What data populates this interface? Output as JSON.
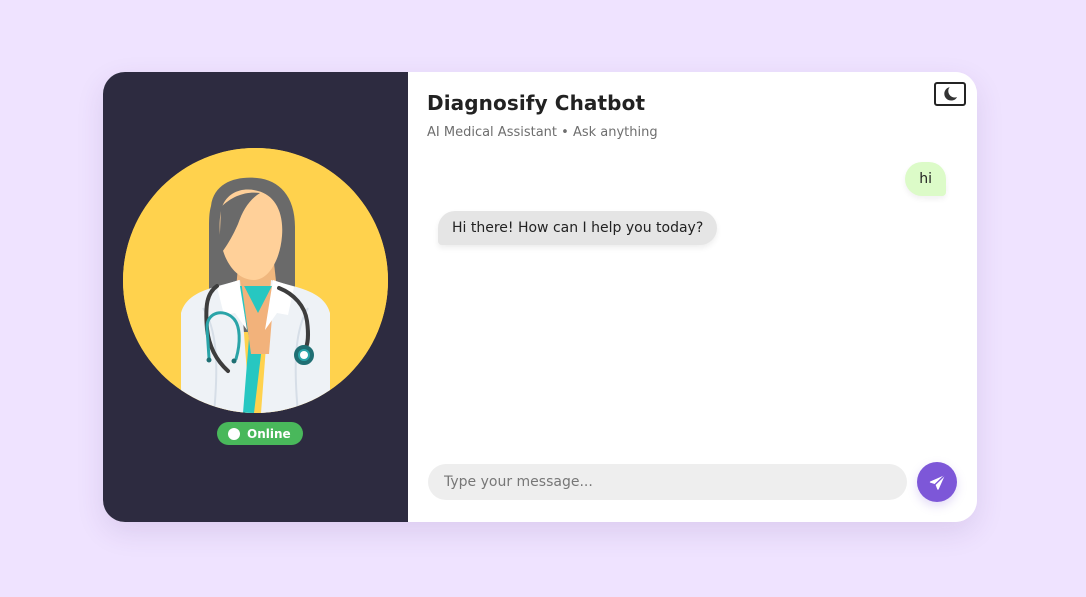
{
  "chat": {
    "title": "Diagnosify Chatbot",
    "subtitle": "AI Medical Assistant • Ask anything",
    "messages": [
      {
        "role": "user",
        "text": "hi"
      },
      {
        "role": "bot",
        "text": "Hi there! How can I help you today?"
      }
    ],
    "input": {
      "value": "",
      "placeholder": "Type your message..."
    }
  },
  "status": {
    "label": "Online"
  },
  "icons": {
    "theme_toggle": "moon-icon",
    "send": "send-icon",
    "avatar": "doctor-avatar-icon"
  },
  "colors": {
    "page_background": "#efe3ff",
    "sidebar_background": "#2d2b40",
    "avatar_background": "#ffd24d",
    "online_green": "#49b85b",
    "user_bubble": "#dcfbc8",
    "bot_bubble": "#e5e5e5",
    "send_button": "#7d57d8"
  }
}
